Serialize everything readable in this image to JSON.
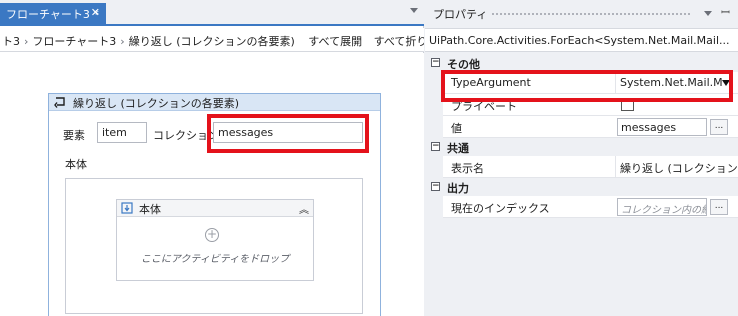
{
  "designer": {
    "tab_title": "フローチャート3 *",
    "tab_close": "✕",
    "breadcrumb": {
      "items": [
        "ト3",
        "フローチャート3",
        "繰り返し (コレクションの各要素)"
      ],
      "separator": "›",
      "expand_all": "すべて展開",
      "collapse_all": "すべて折りたたみ"
    },
    "foreach": {
      "title": "繰り返し (コレクションの各要素)",
      "element_label": "要素",
      "element_value": "item",
      "collection_label": "コレクション",
      "collection_value": "messages",
      "body_label": "本体",
      "inner_sequence_title": "本体",
      "collapse_glyph": "︽",
      "plus_glyph": "+",
      "drop_hint": "ここにアクティビティをドロップ"
    }
  },
  "properties": {
    "title": "プロパティ",
    "pin_glyph": "ꟷ",
    "activity_type": "UiPath.Core.Activities.ForEach<System.Net.Mail.Mail...",
    "categories": [
      {
        "toggle": "−",
        "label": "その他"
      },
      {
        "toggle": "−",
        "label": "共通"
      },
      {
        "toggle": "−",
        "label": "出力"
      }
    ],
    "rows": {
      "type_argument": {
        "name": "TypeArgument",
        "value": "System.Net.Mail.M"
      },
      "private": {
        "name": "プライベート"
      },
      "value": {
        "name": "値",
        "value": "messages"
      },
      "display_name": {
        "name": "表示名",
        "value": "繰り返し (コレクションの"
      },
      "current_index": {
        "name": "現在のインデックス",
        "placeholder": "コレクション内の紹"
      }
    },
    "ellipsis": "..."
  },
  "colors": {
    "accent": "#3b78c3",
    "highlight": "#e4121b"
  }
}
